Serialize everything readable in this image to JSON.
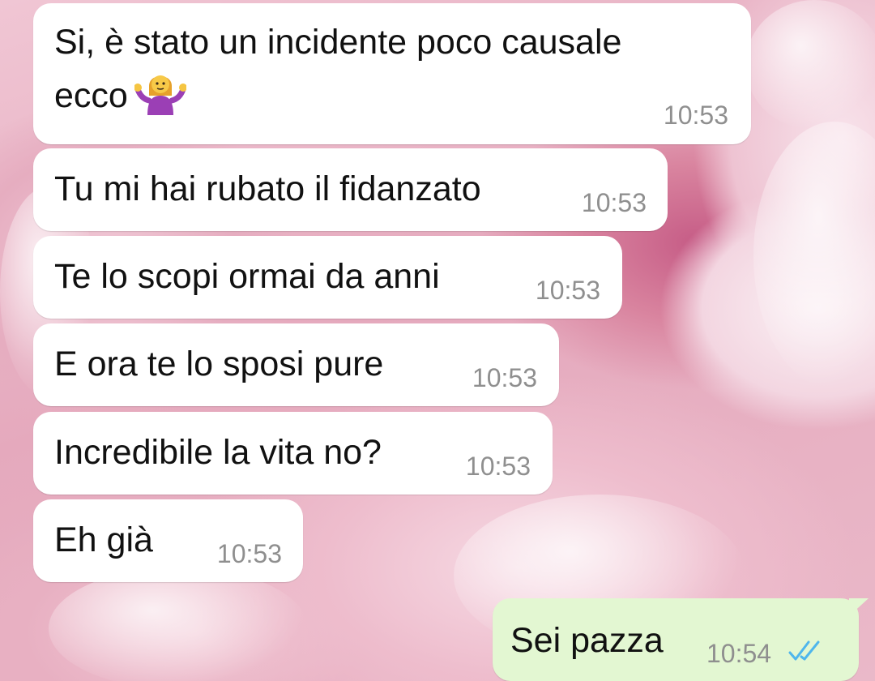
{
  "messages": [
    {
      "direction": "incoming",
      "text_line1": "Si, è stato un incidente poco causale",
      "text_line2": "ecco",
      "emoji": "person-shrugging-emoji",
      "time": "10:53"
    },
    {
      "direction": "incoming",
      "text": "Tu mi hai rubato il fidanzato",
      "time": "10:53"
    },
    {
      "direction": "incoming",
      "text": "Te lo scopi ormai da anni",
      "time": "10:53"
    },
    {
      "direction": "incoming",
      "text": "E ora te lo sposi pure",
      "time": "10:53"
    },
    {
      "direction": "incoming",
      "text": "Incredibile la vita no?",
      "time": "10:53"
    },
    {
      "direction": "incoming",
      "text": "Eh già",
      "time": "10:53"
    },
    {
      "direction": "outgoing",
      "text": "Sei pazza",
      "time": "10:54",
      "status": "read",
      "status_icon": "double-check-icon",
      "status_color": "#4fb6ec"
    }
  ],
  "colors": {
    "incoming_bubble": "#ffffff",
    "outgoing_bubble": "#e3f7d2",
    "timestamp": "#8f8f8f",
    "read_ticks": "#4fb6ec"
  }
}
